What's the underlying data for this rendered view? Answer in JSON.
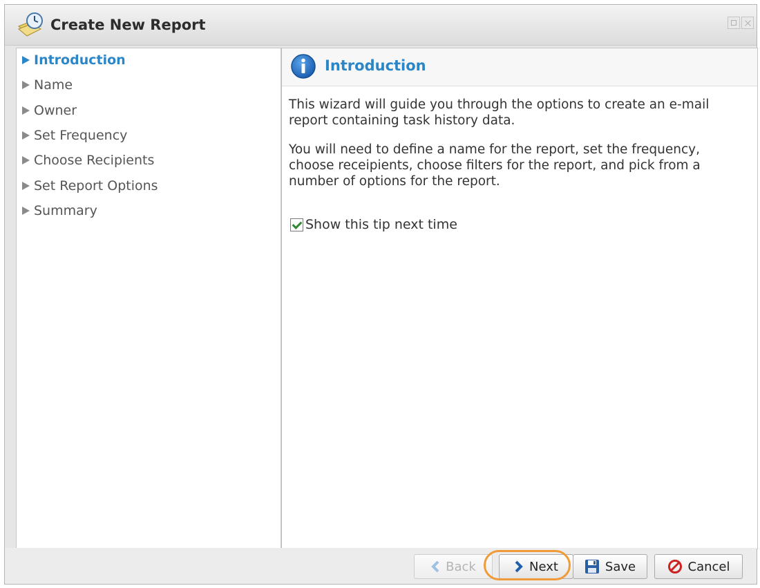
{
  "window": {
    "title": "Create New Report",
    "icon": "report-clock-icon"
  },
  "steps": [
    {
      "label": "Introduction",
      "active": true
    },
    {
      "label": "Name",
      "active": false
    },
    {
      "label": "Owner",
      "active": false
    },
    {
      "label": "Set Frequency",
      "active": false
    },
    {
      "label": "Choose Recipients",
      "active": false
    },
    {
      "label": "Set Report Options",
      "active": false
    },
    {
      "label": "Summary",
      "active": false
    }
  ],
  "content": {
    "icon": "info-icon",
    "title": "Introduction",
    "paragraph1": "This wizard will guide you through the options to create an e-mail report containing task history data.",
    "paragraph2": "You will need to define a name for the report, set the frequency, choose receipients, choose filters for the report, and pick from a number of options for the report.",
    "tip_checkbox": {
      "label": "Show this tip next time",
      "checked": true
    }
  },
  "buttons": {
    "back": {
      "label": "Back",
      "enabled": false,
      "icon": "chevron-left-icon"
    },
    "next": {
      "label": "Next",
      "enabled": true,
      "icon": "chevron-right-icon",
      "highlighted": true
    },
    "save": {
      "label": "Save",
      "enabled": true,
      "icon": "floppy-disk-icon"
    },
    "cancel": {
      "label": "Cancel",
      "enabled": true,
      "icon": "cancel-icon"
    }
  },
  "colors": {
    "accent": "#2b86c8",
    "highlight": "#f19a38",
    "checkmark": "#2f8a2f",
    "cancel_red": "#cc2222"
  }
}
